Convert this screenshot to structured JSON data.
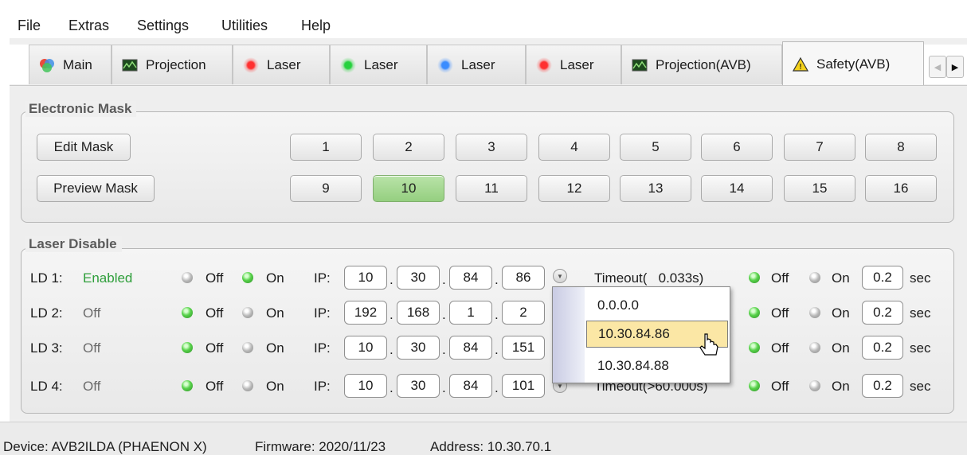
{
  "menu": [
    "File",
    "Extras",
    "Settings",
    "Utilities",
    "Help"
  ],
  "tabs": [
    {
      "label": "Main",
      "icon": "main-color-icon"
    },
    {
      "label": "Projection",
      "icon": "projection-icon"
    },
    {
      "label": "Laser",
      "icon": "red-laser-icon"
    },
    {
      "label": "Laser",
      "icon": "green-laser-icon"
    },
    {
      "label": "Laser",
      "icon": "blue-laser-icon"
    },
    {
      "label": "Laser",
      "icon": "red-laser-icon"
    },
    {
      "label": "Projection(AVB)",
      "icon": "projection-icon"
    },
    {
      "label": "Safety(AVB)",
      "icon": "warning-icon",
      "active": true
    }
  ],
  "electronic_mask": {
    "title": "Electronic Mask",
    "edit_label": "Edit Mask",
    "preview_label": "Preview Mask",
    "buttons": [
      "1",
      "2",
      "3",
      "4",
      "5",
      "6",
      "7",
      "8",
      "9",
      "10",
      "11",
      "12",
      "13",
      "14",
      "15",
      "16"
    ],
    "selected": "10"
  },
  "laser_disable": {
    "title": "Laser Disable",
    "off_label": "Off",
    "on_label": "On",
    "ip_label": "IP:",
    "sec_label": "sec",
    "rows": [
      {
        "label": "LD 1:",
        "status": "Enabled",
        "ip": [
          "10",
          "30",
          "84",
          "86"
        ],
        "timeout": "Timeout(   0.033s)",
        "value": "0.2"
      },
      {
        "label": "LD 2:",
        "status": "Off",
        "ip": [
          "192",
          "168",
          "1",
          "2"
        ],
        "timeout": "",
        "value": "0.2"
      },
      {
        "label": "LD 3:",
        "status": "Off",
        "ip": [
          "10",
          "30",
          "84",
          "151"
        ],
        "timeout": "",
        "value": "0.2"
      },
      {
        "label": "LD 4:",
        "status": "Off",
        "ip": [
          "10",
          "30",
          "84",
          "101"
        ],
        "timeout": "Timeout(>60.000s)",
        "value": "0.2"
      }
    ]
  },
  "dropdown": {
    "items": [
      "0.0.0.0",
      "10.30.84.86",
      "10.30.84.88"
    ],
    "highlighted": "10.30.84.86"
  },
  "status": {
    "device": "Device: AVB2ILDA (PHAENON X)",
    "firmware": "Firmware: 2020/11/23",
    "address": "Address: 10.30.70.1"
  },
  "colors": {
    "selected_button": "#95cf80",
    "enabled_text": "#2e9e3a",
    "highlight": "#fbe7a5"
  }
}
